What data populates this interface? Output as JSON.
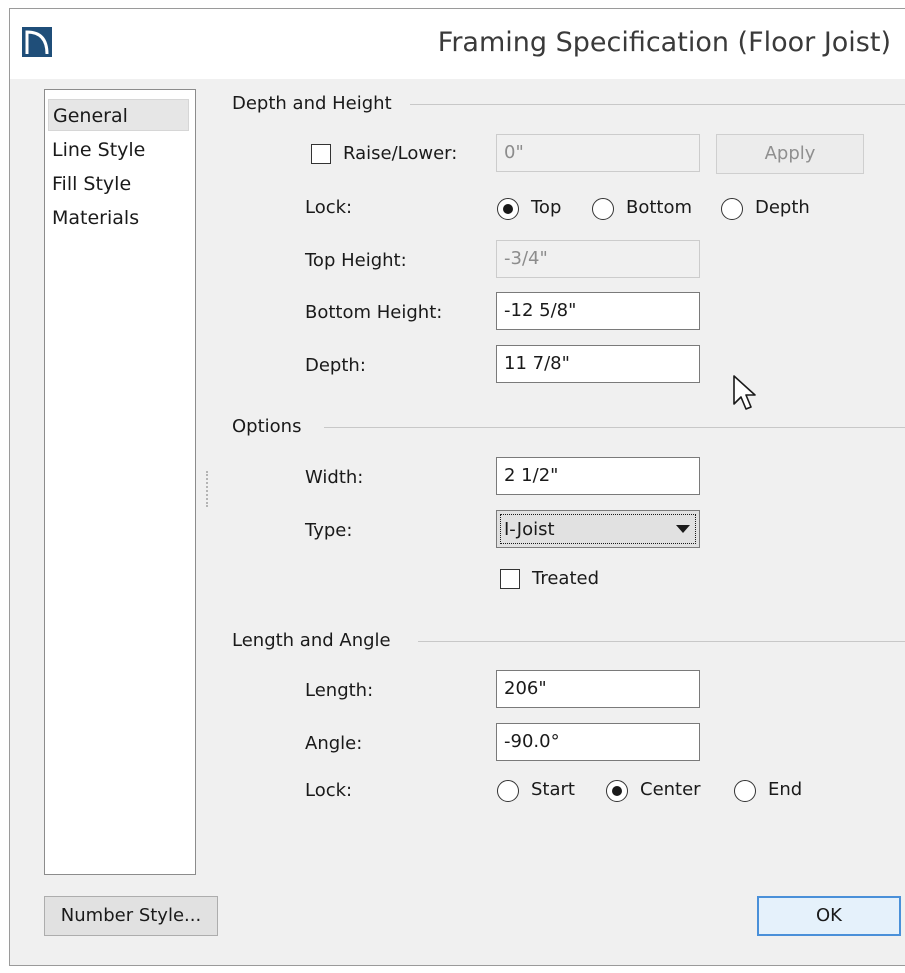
{
  "window": {
    "title": "Framing Specification (Floor Joist)"
  },
  "nav": {
    "items": [
      {
        "label": "General",
        "selected": true
      },
      {
        "label": "Line Style",
        "selected": false
      },
      {
        "label": "Fill Style",
        "selected": false
      },
      {
        "label": "Materials",
        "selected": false
      }
    ]
  },
  "depth_height": {
    "group_title": "Depth and Height",
    "raise_lower_label": "Raise/Lower:",
    "raise_lower_checked": false,
    "raise_lower_value": "0\"",
    "apply_label": "Apply",
    "lock_label": "Lock:",
    "lock_options": [
      "Top",
      "Bottom",
      "Depth"
    ],
    "lock_selected": "Top",
    "top_height_label": "Top Height:",
    "top_height_value": "-3/4\"",
    "bottom_height_label": "Bottom Height:",
    "bottom_height_value": "-12 5/8\"",
    "depth_label": "Depth:",
    "depth_value": "11 7/8\""
  },
  "options": {
    "group_title": "Options",
    "width_label": "Width:",
    "width_value": "2 1/2\"",
    "type_label": "Type:",
    "type_value": "I-Joist",
    "treated_label": "Treated",
    "treated_checked": false
  },
  "length_angle": {
    "group_title": "Length and Angle",
    "length_label": "Length:",
    "length_value": "206\"",
    "angle_label": "Angle:",
    "angle_value": "-90.0°",
    "lock_label": "Lock:",
    "lock_options": [
      "Start",
      "Center",
      "End"
    ],
    "lock_selected": "Center"
  },
  "footer": {
    "number_style_label": "Number Style...",
    "ok_label": "OK"
  },
  "colors": {
    "window_bg": "#f0f0f0",
    "default_button_border": "#4a90d9",
    "app_icon": "#1f4e79"
  }
}
